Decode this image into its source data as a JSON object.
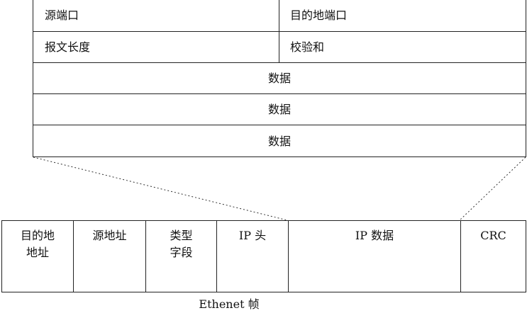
{
  "packet": {
    "row1": {
      "left": "源端口",
      "right": "目的地端口"
    },
    "row2": {
      "left": "报文长度",
      "right": "校验和"
    },
    "row3": "数据",
    "row4": "数据",
    "row5": "数据"
  },
  "frame": {
    "cells": [
      {
        "line1": "目的地",
        "line2": "地址"
      },
      {
        "line1": "源地址",
        "line2": ""
      },
      {
        "line1": "类型",
        "line2": "字段"
      },
      {
        "line1": "IP 头",
        "line2": ""
      },
      {
        "line1": "IP 数据",
        "line2": ""
      },
      {
        "line1": "CRC",
        "line2": ""
      }
    ],
    "caption": "Ethenet 帧"
  }
}
